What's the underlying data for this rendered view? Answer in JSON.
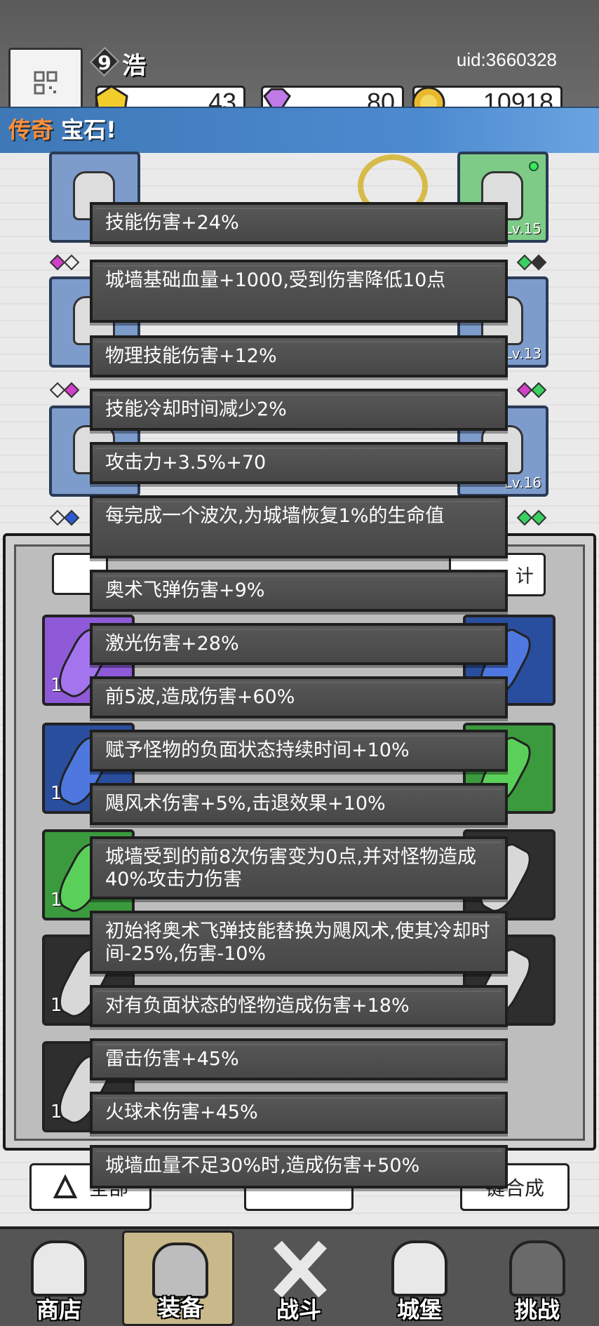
{
  "header": {
    "level": "9",
    "player_name": "浩",
    "uid": "uid:3660328",
    "currencies": [
      {
        "icon": "yellow-gem-icon",
        "value": "43"
      },
      {
        "icon": "purple-diamond-icon",
        "value": "80"
      },
      {
        "icon": "gold-coin-icon",
        "value": "10918"
      }
    ]
  },
  "banner": {
    "highlight": "传奇",
    "text": " 宝石!"
  },
  "equipment": {
    "levels": [
      "Lv.15",
      "Lv.13",
      "Lv.16"
    ]
  },
  "inventory": {
    "stat_button": "计",
    "counts": [
      "1",
      "1",
      "1",
      "1",
      "1"
    ]
  },
  "affixes": [
    "技能伤害+24%",
    "城墙基础血量+1000,受到伤害降低10点",
    "物理技能伤害+12%",
    "技能冷却时间减少2%",
    "攻击力+3.5%+70",
    "每完成一个波次,为城墙恢复1%的生命值",
    "奥术飞弹伤害+9%",
    "激光伤害+28%",
    "前5波,造成伤害+60%",
    "赋予怪物的负面状态持续时间+10%",
    "飓风术伤害+5%,击退效果+10%",
    "城墙受到的前8次伤害变为0点,并对怪物造成40%攻击力伤害",
    "初始将奥术飞弹技能替换为飓风术,使其冷却时间-25%,伤害-10%",
    "对有负面状态的怪物造成伤害+18%",
    "雷击伤害+45%",
    "火球术伤害+45%",
    "城墙血量不足30%时,造成伤害+50%"
  ],
  "bottom_buttons": {
    "left": "全部",
    "right": "键合成"
  },
  "nav": [
    {
      "label": "商店",
      "icon": "shop-icon"
    },
    {
      "label": "装备",
      "icon": "backpack-icon"
    },
    {
      "label": "战斗",
      "icon": "crossed-swords-icon"
    },
    {
      "label": "城堡",
      "icon": "castle-icon"
    },
    {
      "label": "挑战",
      "icon": "locked-challenge-icon"
    }
  ],
  "colors": {
    "banner": "#4c8ad0",
    "legend_highlight": "#ff8f3a",
    "affix_bg": "#4f4f4f"
  }
}
